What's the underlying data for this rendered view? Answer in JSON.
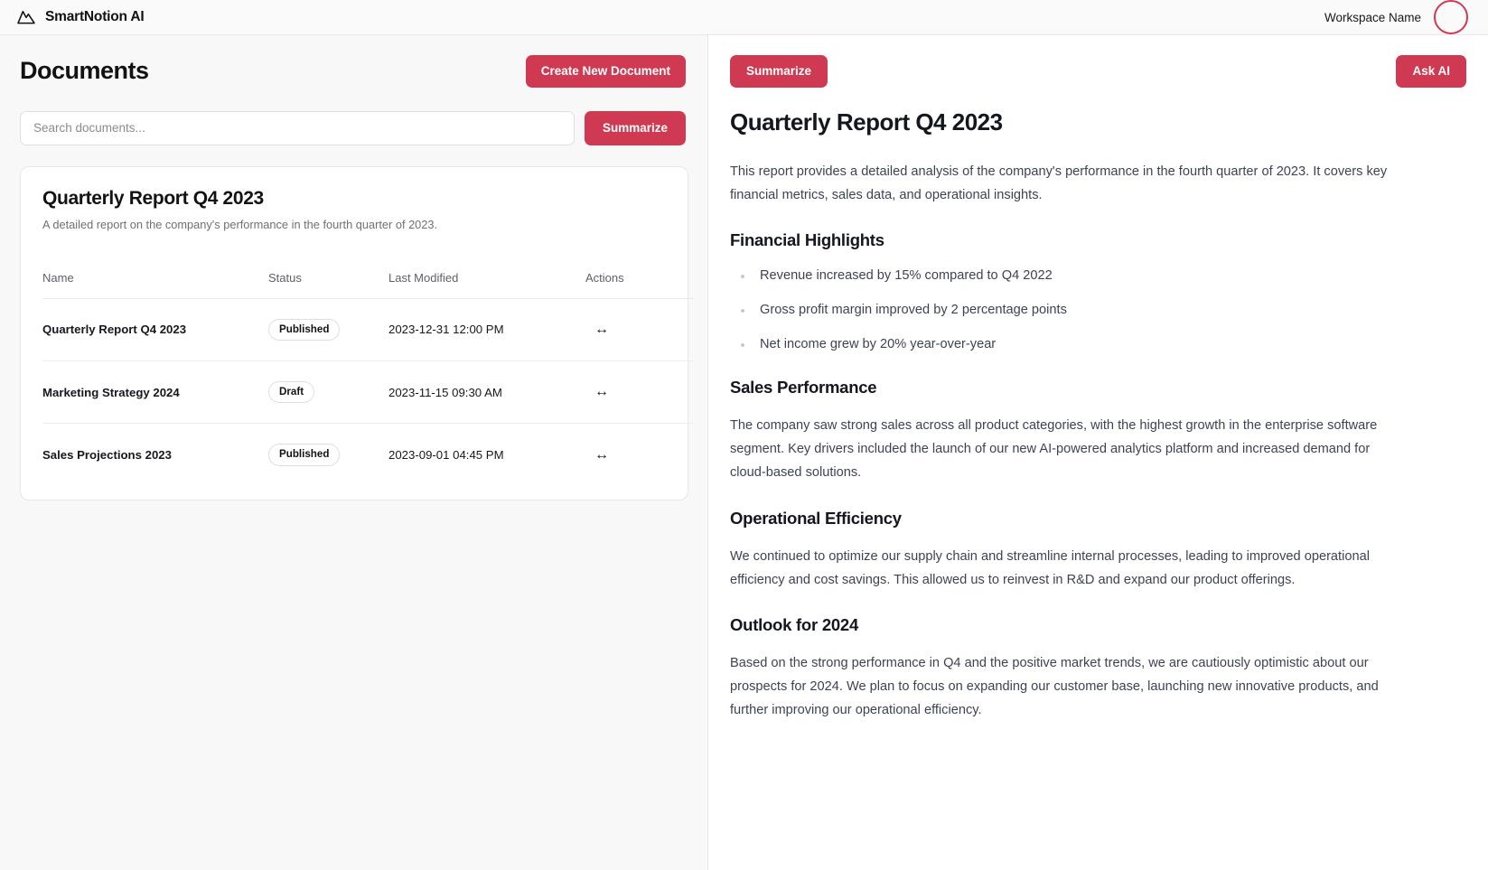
{
  "theme": {
    "accent": "#cf3a52",
    "left_bg": "#f8f8f9",
    "right_bg": "#ffffff",
    "text": "#111214",
    "muted": "#6e7077"
  },
  "topbar": {
    "logo_icon": "mountain-icon",
    "brand": "SmartNotion AI",
    "workspace": "Workspace Name",
    "avatar_icon": "avatar"
  },
  "left": {
    "title": "Documents",
    "create_button": "Create New Document",
    "search": {
      "placeholder": "Search documents...",
      "value": ""
    },
    "summarize_button": "Summarize",
    "card": {
      "title": "Quarterly Report Q4 2023",
      "description": "A detailed report on the company's performance in the fourth quarter of 2023.",
      "columns": [
        "Name",
        "Status",
        "Last Modified",
        "Actions"
      ],
      "rows": [
        {
          "name": "Quarterly Report Q4 2023",
          "status": "Published",
          "modified": "2023-12-31 12:00 PM",
          "action_icon": "↔"
        },
        {
          "name": "Marketing Strategy 2024",
          "status": "Draft",
          "modified": "2023-11-15 09:30 AM",
          "action_icon": "↔"
        },
        {
          "name": "Sales Projections 2023",
          "status": "Published",
          "modified": "2023-09-01 04:45 PM",
          "action_icon": "↔"
        }
      ]
    }
  },
  "right": {
    "summarize_button": "Summarize",
    "ask_ai_button": "Ask AI",
    "title": "Quarterly Report Q4 2023",
    "intro": "This report provides a detailed analysis of the company's performance in the fourth quarter of 2023. It covers key financial metrics, sales data, and operational insights.",
    "sections": [
      {
        "heading": "Financial Highlights",
        "bullets": [
          "Revenue increased by 15% compared to Q4 2022",
          "Gross profit margin improved by 2 percentage points",
          "Net income grew by 20% year-over-year"
        ]
      },
      {
        "heading": "Sales Performance",
        "paragraph": "The company saw strong sales across all product categories, with the highest growth in the enterprise software segment. Key drivers included the launch of our new AI-powered analytics platform and increased demand for cloud-based solutions."
      },
      {
        "heading": "Operational Efficiency",
        "paragraph": "We continued to optimize our supply chain and streamline internal processes, leading to improved operational efficiency and cost savings. This allowed us to reinvest in R&D and expand our product offerings."
      },
      {
        "heading": "Outlook for 2024",
        "paragraph": "Based on the strong performance in Q4 and the positive market trends, we are cautiously optimistic about our prospects for 2024. We plan to focus on expanding our customer base, launching new innovative products, and further improving our operational efficiency."
      }
    ]
  }
}
